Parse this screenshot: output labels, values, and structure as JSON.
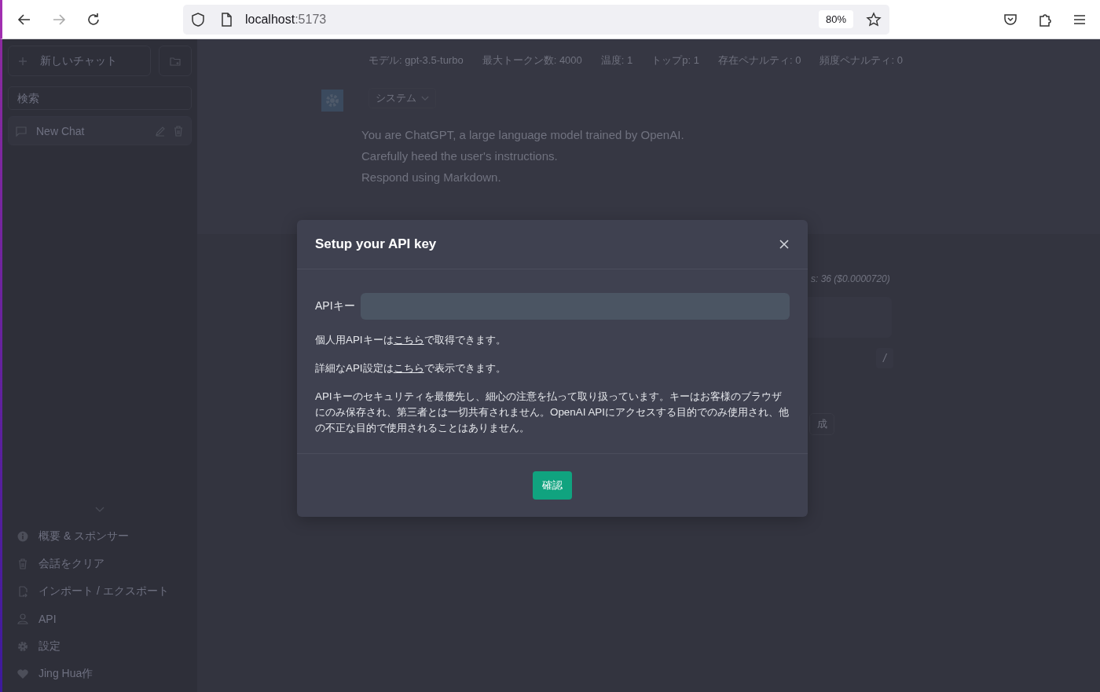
{
  "browser": {
    "url_host": "localhost",
    "url_port": ":5173",
    "zoom": "80%"
  },
  "sidebar": {
    "new_chat": "新しいチャット",
    "search_placeholder": "検索",
    "chats": [
      {
        "title": "New Chat",
        "selected": true
      }
    ],
    "menu": [
      {
        "kind": "info",
        "label": "概要 & スポンサー"
      },
      {
        "kind": "trash",
        "label": "会話をクリア"
      },
      {
        "kind": "file",
        "label": "インポート / エクスポート"
      },
      {
        "kind": "user",
        "label": "API"
      },
      {
        "kind": "gear",
        "label": "設定"
      },
      {
        "kind": "heart",
        "label": "Jing Hua作"
      }
    ]
  },
  "main": {
    "settings": [
      "モデル: gpt-3.5-turbo",
      "最大トークン数: 4000",
      "温度: 1",
      "トップp: 1",
      "存在ペナルティ: 0",
      "頻度ペナルティ: 0"
    ],
    "role": "システム",
    "system_prompt": [
      "You are ChatGPT, a large language model trained by OpenAI.",
      "Carefully heed the user's instructions.",
      "Respond using Markdown."
    ],
    "token_count": "s: 36 ($0.0000720)",
    "command_key": "/",
    "generate_button": "成"
  },
  "modal": {
    "title": "Setup your API key",
    "api_key_label": "APIキー",
    "notes": [
      {
        "before": "個人用APIキーは",
        "link": "こちら",
        "after": "で取得できます。"
      },
      {
        "before": "詳細なAPI設定は",
        "link": "こちら",
        "after": "で表示できます。"
      }
    ],
    "security_note": "APIキーのセキュリティを最優先し、細心の注意を払って取り扱っています。キーはお客様のブラウザにのみ保存され、第三者とは一切共有されません。OpenAI APIにアクセスする目的でのみ使用され、他の不正な目的で使用されることはありません。",
    "confirm_button": "確認"
  }
}
